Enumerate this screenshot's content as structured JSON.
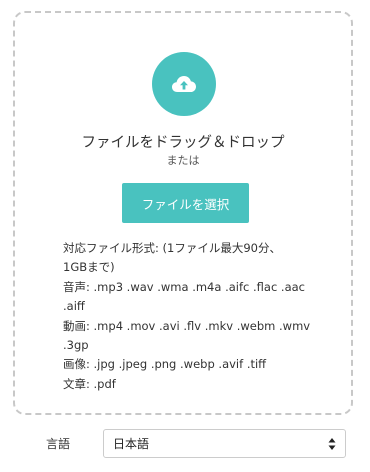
{
  "upload": {
    "title": "ファイルをドラッグ＆ドロップ",
    "or": "または",
    "select_label": "ファイルを選択",
    "icon": "cloud-upload-icon",
    "accent": "#49c2bf"
  },
  "formats": {
    "lines": [
      "対応ファイル形式: (1ファイル最大90分、",
      "1GBまで)",
      "音声: .mp3 .wav .wma .m4a .aifc .flac .aac",
      ".aiff",
      "動画: .mp4 .mov .avi .flv .mkv .webm .wmv",
      ".3gp",
      "画像: .jpg .jpeg .png .webp .avif .tiff",
      "文章: .pdf"
    ]
  },
  "language": {
    "label": "言語",
    "selected": "日本語",
    "icon": "select-arrows-icon"
  }
}
